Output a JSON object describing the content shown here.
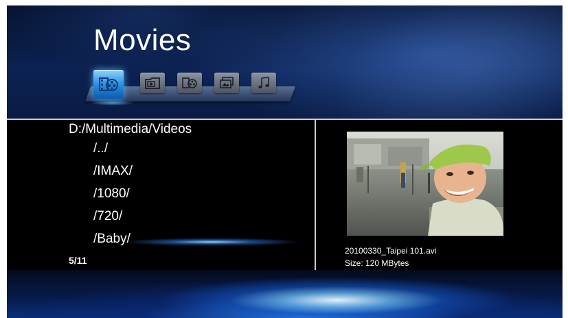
{
  "header": {
    "title": "Movies"
  },
  "categories": [
    {
      "icon": "movie-reel-icon",
      "active": true
    },
    {
      "icon": "photo-folder-icon",
      "active": false
    },
    {
      "icon": "movie-reel-icon",
      "active": false
    },
    {
      "icon": "photo-slides-icon",
      "active": false
    },
    {
      "icon": "music-note-icon",
      "active": false
    }
  ],
  "browser": {
    "path": "D:/Multimedia/Videos",
    "items": [
      "/../",
      "/IMAX/",
      "/1080/",
      "/720/",
      "/Baby/"
    ],
    "selected_index": 4,
    "counter": "5/11"
  },
  "preview": {
    "image": "photo-of-smiling-child-in-green-cap",
    "file_name": "20100330_Taipei 101.avi",
    "file_size": "Size: 120 MBytes"
  },
  "colors": {
    "accent": "#2a8fe0",
    "header_bg": "#0c2252",
    "panel_border": "#cfcfcf",
    "text": "#ffffff"
  }
}
